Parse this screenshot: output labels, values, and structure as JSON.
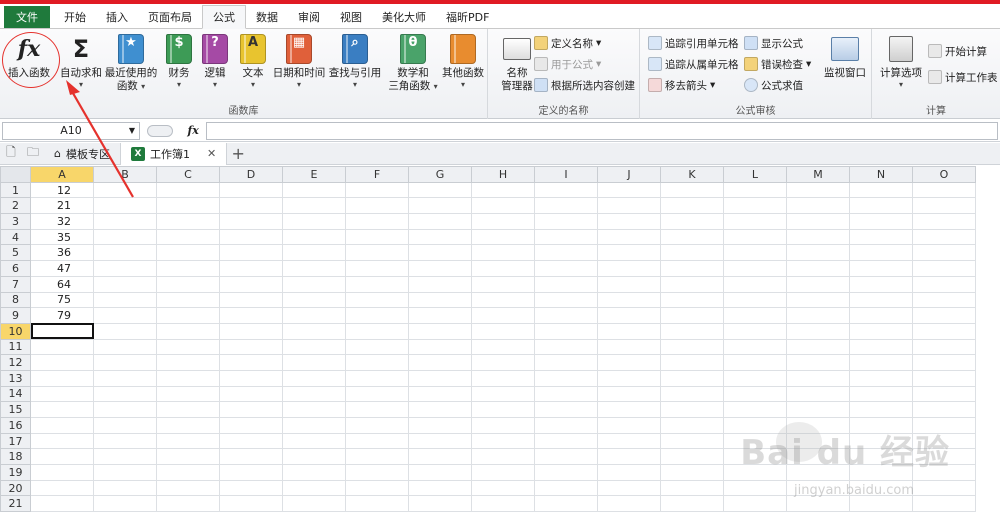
{
  "menu": {
    "tabs": [
      "文件",
      "开始",
      "插入",
      "页面布局",
      "公式",
      "数据",
      "审阅",
      "视图",
      "美化大师",
      "福昕PDF"
    ],
    "active_index": 4
  },
  "ribbon": {
    "function_library": {
      "label": "函数库",
      "insert_function": "插入函数",
      "autosum": "自动求和",
      "recent_l1": "最近使用的",
      "recent_l2": "函数",
      "financial": "财务",
      "logical": "逻辑",
      "text": "文本",
      "datetime": "日期和时间",
      "lookup": "查找与引用",
      "math_l1": "数学和",
      "math_l2": "三角函数",
      "other": "其他函数"
    },
    "defined_names": {
      "label": "定义的名称",
      "name_manager_l1": "名称",
      "name_manager_l2": "管理器",
      "define_name": "定义名称",
      "use_in_formula": "用于公式",
      "create_from_selection": "根据所选内容创建"
    },
    "formula_auditing": {
      "label": "公式审核",
      "trace_precedents": "追踪引用单元格",
      "trace_dependents": "追踪从属单元格",
      "remove_arrows": "移去箭头",
      "show_formulas": "显示公式",
      "error_checking": "错误检查",
      "evaluate_formula": "公式求值",
      "watch_window": "监视窗口"
    },
    "calculation": {
      "label": "计算",
      "calc_options": "计算选项",
      "calc_now": "开始计算",
      "calc_sheet": "计算工作表"
    }
  },
  "formula_bar": {
    "name_box": "A10",
    "fx": "fx",
    "content": ""
  },
  "doc_tabs": {
    "template": "模板专区",
    "workbook": "工作簿1",
    "close": "✕",
    "add": "+"
  },
  "sheet": {
    "columns": [
      "A",
      "B",
      "C",
      "D",
      "E",
      "F",
      "G",
      "H",
      "I",
      "J",
      "K",
      "L",
      "M",
      "N",
      "O"
    ],
    "row_count": 21,
    "column_a_values": [
      "12",
      "21",
      "32",
      "35",
      "36",
      "47",
      "64",
      "75",
      "79"
    ],
    "selected_cell": "A10"
  },
  "watermark": {
    "main": "Bai du 经验",
    "sub": "jingyan.baidu.com"
  },
  "colors": {
    "file_tab": "#1f7a3c",
    "annotation": "#e5322d",
    "active_header": "#f8d66a"
  }
}
